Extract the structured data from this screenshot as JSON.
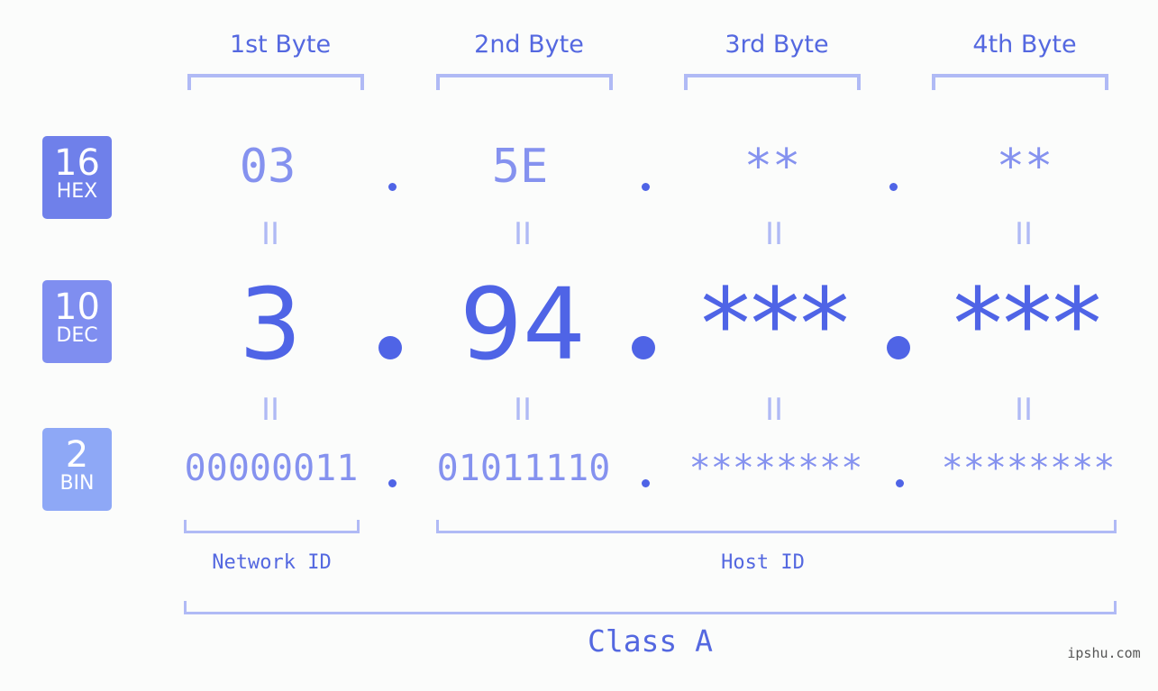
{
  "bases": [
    {
      "num": "16",
      "label": "HEX",
      "color": "#6f80ea"
    },
    {
      "num": "10",
      "label": "DEC",
      "color": "#7f8ef0"
    },
    {
      "num": "2",
      "label": "BIN",
      "color": "#8ea8f6"
    }
  ],
  "byte_headers": [
    "1st Byte",
    "2nd Byte",
    "3rd Byte",
    "4th Byte"
  ],
  "hex": [
    "03",
    "5E",
    "**",
    "**"
  ],
  "dec": [
    "3",
    "94",
    "***",
    "***"
  ],
  "bin": [
    "00000011",
    "01011110",
    "********",
    "********"
  ],
  "equals": "II",
  "network_id": "Network ID",
  "host_id": "Host ID",
  "class_label": "Class A",
  "watermark": "ipshu.com"
}
